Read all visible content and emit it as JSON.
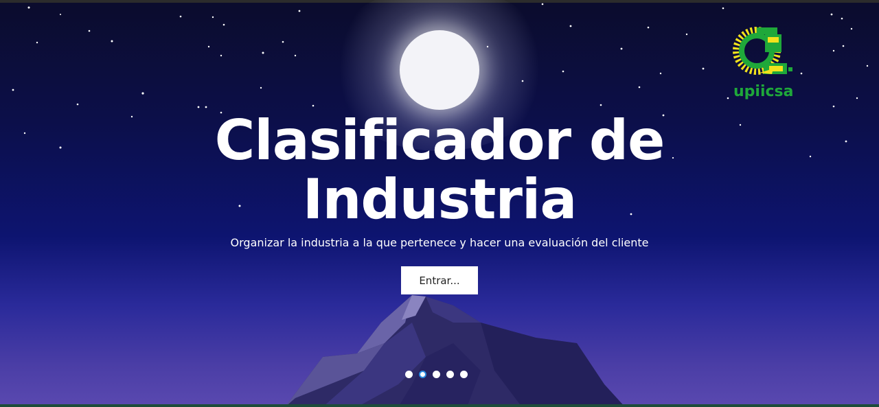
{
  "hero": {
    "title_line1": "Clasificador de",
    "title_line2": "Industria",
    "subtitle": "Organizar la industria a la que pertenece y hacer una evaluación del cliente",
    "cta_label": "Entrar..."
  },
  "logo": {
    "text": "upiicsa",
    "icon": "upiicsa-logo"
  },
  "carousel": {
    "slide_count": 5,
    "active_index": 1
  },
  "colors": {
    "sky_top": "#0b0c2c",
    "sky_bottom": "#5a49b0",
    "logo_green": "#1fa83a",
    "logo_yellow": "#f2e21c",
    "active_dot_border": "#2a8ae0"
  }
}
